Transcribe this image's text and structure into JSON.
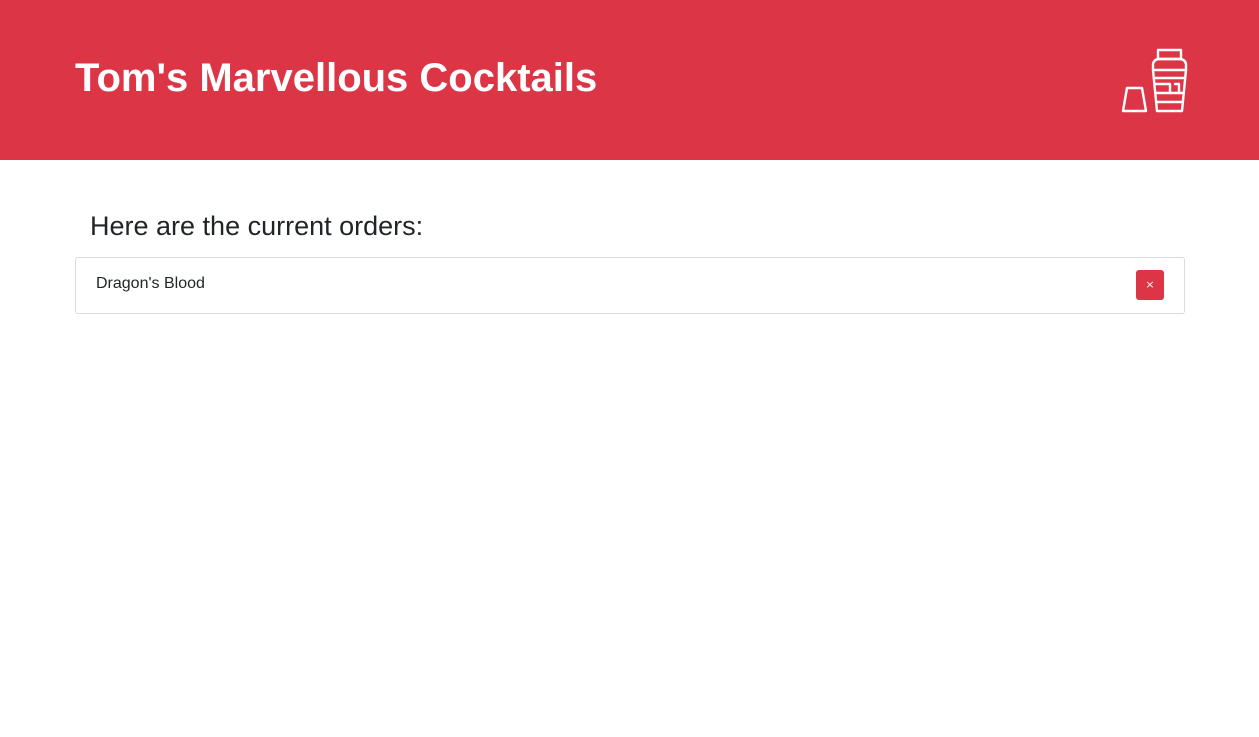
{
  "app": {
    "title": "Tom's Marvellous Cocktails",
    "logo_icon": "cocktail-shaker-icon"
  },
  "main": {
    "heading": "Here are the current orders:",
    "orders": [
      {
        "name": "Dragon's Blood",
        "remove_label": "×"
      }
    ]
  },
  "colors": {
    "brand": "#dc3545",
    "header_text": "#ffffff",
    "body_text": "#212529",
    "border": "#dcdcdc"
  }
}
